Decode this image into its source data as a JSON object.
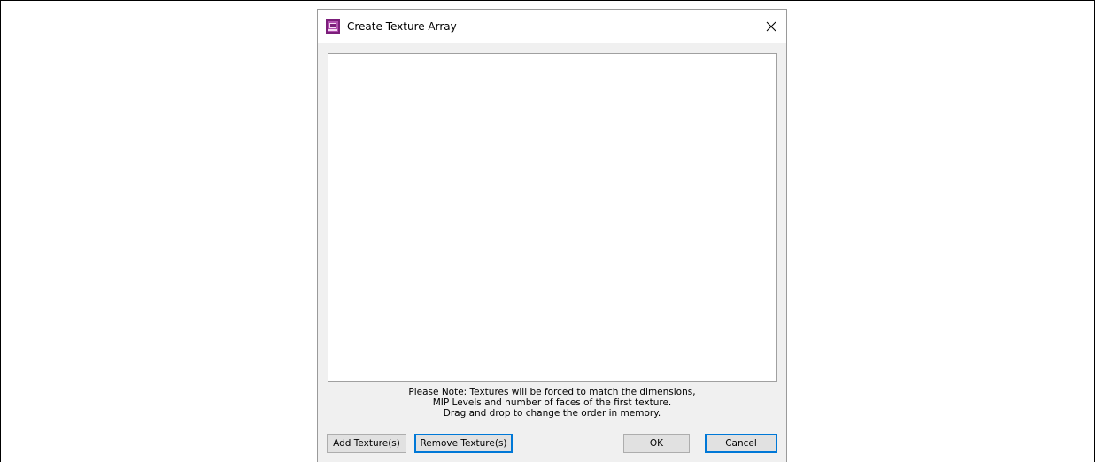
{
  "dialog": {
    "title": "Create Texture Array",
    "icon": "texture-app-icon",
    "close_icon": "close-icon"
  },
  "texture_list": {
    "items": []
  },
  "note": {
    "line1": "Please Note: Textures will be forced to match the dimensions,",
    "line2": "MIP Levels and number of faces of the first texture.",
    "line3": "Drag and drop to change the order in memory."
  },
  "buttons": {
    "add": "Add Texture(s)",
    "remove": "Remove Texture(s)",
    "ok": "OK",
    "cancel": "Cancel"
  },
  "colors": {
    "focus": "#0078d7",
    "icon_purple": "#7b1e7a"
  }
}
